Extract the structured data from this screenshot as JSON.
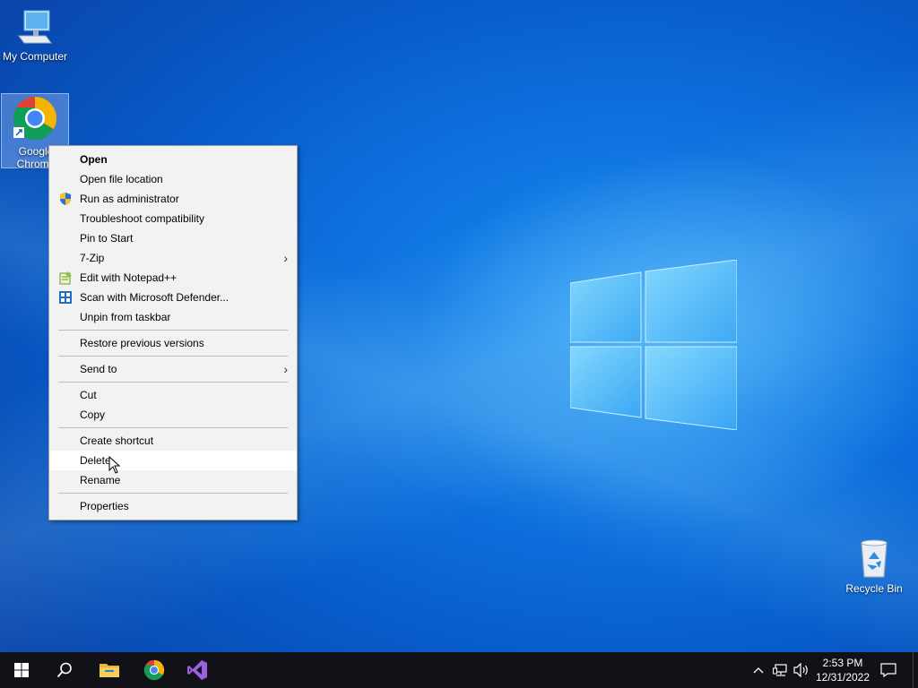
{
  "desktop": {
    "icons": [
      {
        "label": "My Computer"
      },
      {
        "label": "Google Chrome"
      },
      {
        "label": "Recycle Bin"
      }
    ]
  },
  "context_menu": {
    "items": [
      {
        "label": "Open"
      },
      {
        "label": "Open file location"
      },
      {
        "label": "Run as administrator"
      },
      {
        "label": "Troubleshoot compatibility"
      },
      {
        "label": "Pin to Start"
      },
      {
        "label": "7-Zip"
      },
      {
        "label": "Edit with Notepad++"
      },
      {
        "label": "Scan with Microsoft Defender..."
      },
      {
        "label": "Unpin from taskbar"
      },
      {
        "label": "Restore previous versions"
      },
      {
        "label": "Send to"
      },
      {
        "label": "Cut"
      },
      {
        "label": "Copy"
      },
      {
        "label": "Create shortcut"
      },
      {
        "label": "Delete"
      },
      {
        "label": "Rename"
      },
      {
        "label": "Properties"
      }
    ]
  },
  "taskbar": {
    "time": "2:53 PM",
    "date": "12/31/2022",
    "pinned_icons": [
      "windows-start-icon",
      "search-icon",
      "file-explorer-icon",
      "chrome-icon",
      "visual-studio-icon"
    ]
  },
  "colors": {
    "wallpaper": "#0d6fdc",
    "taskbar": "#101218",
    "menu_bg": "#f2f2f2"
  }
}
